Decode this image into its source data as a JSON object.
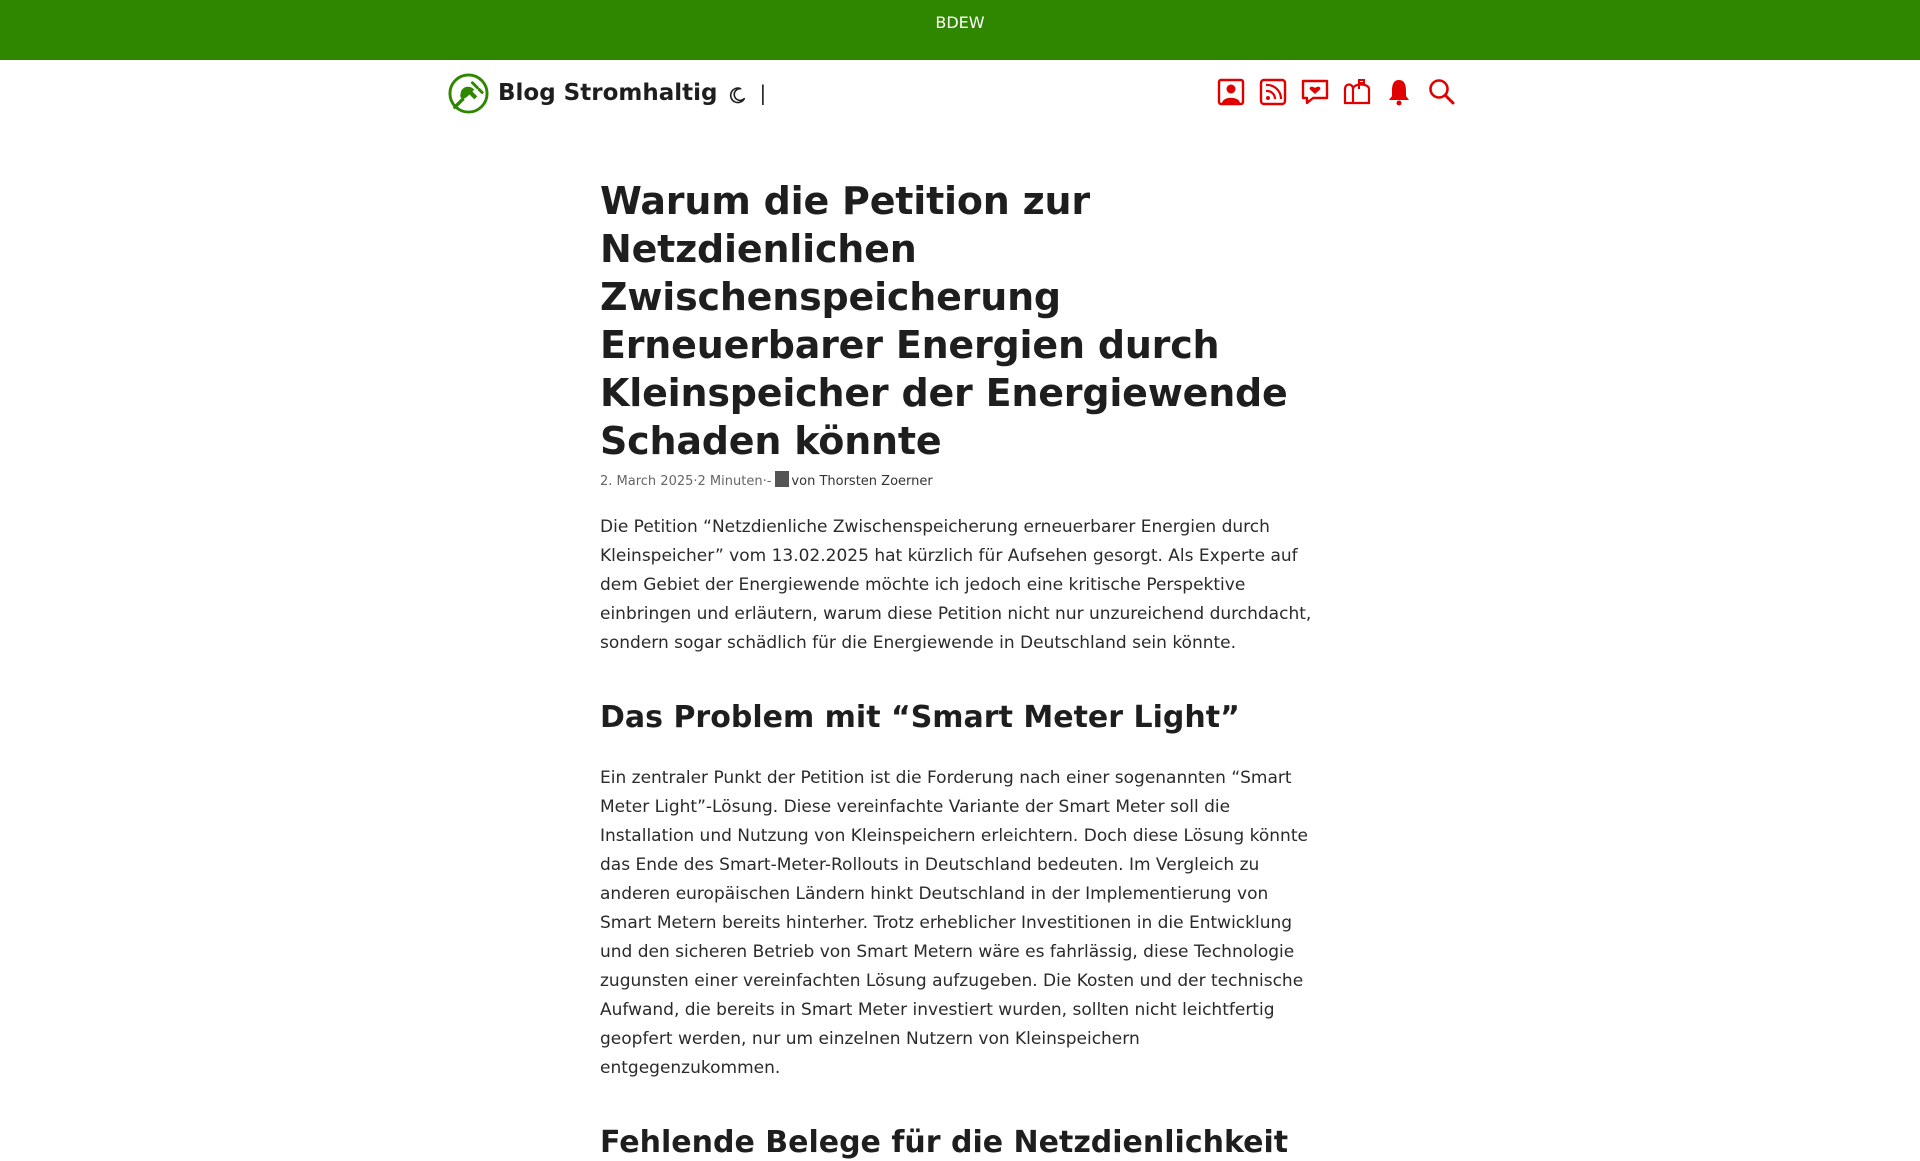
{
  "topbar": {
    "label": "BDEW"
  },
  "header": {
    "title": "Blog Stromhaltig",
    "separator": "|",
    "icons": [
      "user-icon",
      "rss-icon",
      "heart-chat-icon",
      "mailbox-icon",
      "bell-icon",
      "search-icon"
    ]
  },
  "colors": {
    "brand_green": "#2f8700",
    "icon_red": "#e00000"
  },
  "article": {
    "title": "Warum die Petition zur Netzdienlichen Zwischenspeicherung Erneuerbarer Energien durch Kleinspeicher der Energiewende Schaden könnte",
    "meta": {
      "date": "2. March 2025",
      "dot1": " · ",
      "read_time": "2 Minuten",
      "dot2": " · ",
      "dash": "-",
      "author": "von Thorsten Zoerner"
    },
    "intro": "Die Petition “Netzdienliche Zwischenspeicherung erneuerbarer Energien durch Kleinspeicher” vom 13.02.2025 hat kürzlich für Aufsehen gesorgt. Als Experte auf dem Gebiet der Energiewende möchte ich jedoch eine kritische Perspektive einbringen und erläutern, warum diese Petition nicht nur unzureichend durchdacht, sondern sogar schädlich für die Energiewende in Deutschland sein könnte.",
    "section1_heading": "Das Problem mit “Smart Meter Light”",
    "section1_body": "Ein zentraler Punkt der Petition ist die Forderung nach einer sogenannten “Smart Meter Light”-Lösung. Diese vereinfachte Variante der Smart Meter soll die Installation und Nutzung von Kleinspeichern erleichtern. Doch diese Lösung könnte das Ende des Smart-Meter-Rollouts in Deutschland bedeuten. Im Vergleich zu anderen europäischen Ländern hinkt Deutschland in der Implementierung von Smart Metern bereits hinterher. Trotz erheblicher Investitionen in die Entwicklung und den sicheren Betrieb von Smart Metern wäre es fahrlässig, diese Technologie zugunsten einer vereinfachten Lösung aufzugeben. Die Kosten und der technische Aufwand, die bereits in Smart Meter investiert wurden, sollten nicht leichtfertig geopfert werden, nur um einzelnen Nutzern von Kleinspeichern entgegenzukommen.",
    "section2_heading": "Fehlende Belege für die Netzdienlichkeit"
  }
}
